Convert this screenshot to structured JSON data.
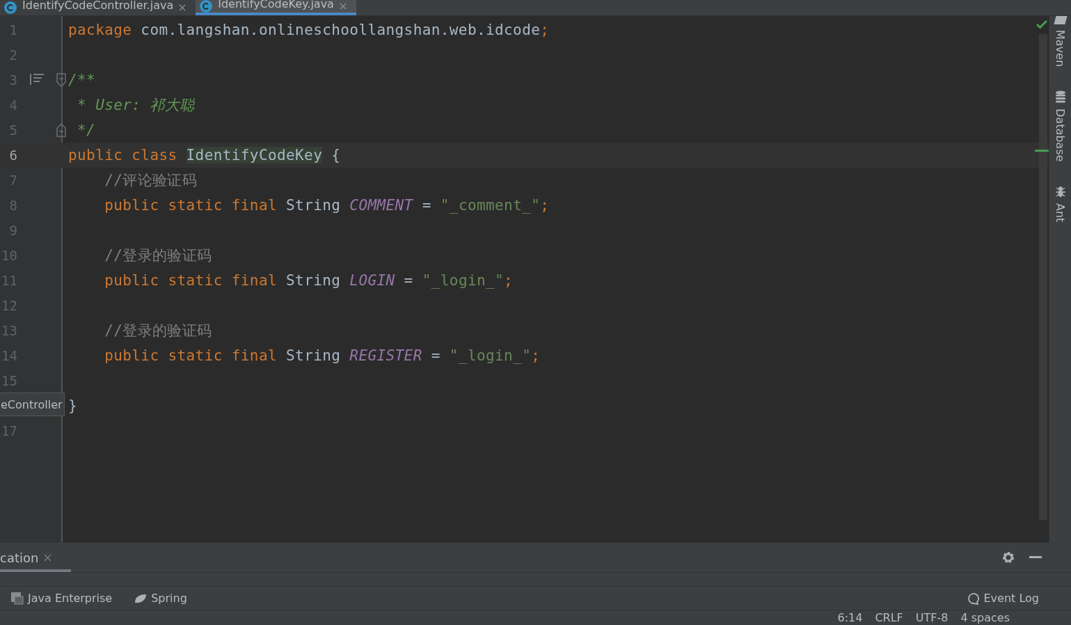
{
  "tabs": [
    {
      "label": "IdentifyCodeController.java",
      "selected": false
    },
    {
      "label": "IdentifyCodeKey.java",
      "selected": true
    }
  ],
  "editor": {
    "lines": [
      {
        "number": "1",
        "kind": "code",
        "current": false,
        "tokens": [
          {
            "kind": "keyword",
            "text": "package"
          },
          {
            "kind": "plain",
            "text": " com.langshan.onlineschoollangshan.web.idcode"
          },
          {
            "kind": "keyword",
            "text": ";"
          }
        ]
      },
      {
        "number": "2",
        "kind": "code",
        "current": false
      },
      {
        "number": "3",
        "kind": "fold-start",
        "current": false,
        "tokens": [
          {
            "kind": "doc",
            "text": "/**"
          }
        ]
      },
      {
        "number": "4",
        "kind": "code",
        "current": false,
        "tokens": [
          {
            "kind": "doc",
            "text": " * User: "
          },
          {
            "kind": "doc",
            "text": "祁大聪"
          }
        ]
      },
      {
        "number": "5",
        "kind": "fold-end",
        "current": false,
        "tokens": [
          {
            "kind": "doc",
            "text": " */"
          }
        ]
      },
      {
        "number": "6",
        "kind": "code",
        "current": true,
        "tokens": [
          {
            "kind": "keyword",
            "text": "public class "
          },
          {
            "kind": "match",
            "text": "IdentifyCodeKey"
          },
          {
            "kind": "plain",
            "text": " {"
          }
        ]
      },
      {
        "number": "7",
        "kind": "code",
        "current": false,
        "tokens": [
          {
            "kind": "comment",
            "text": "    //评论验证码"
          }
        ]
      },
      {
        "number": "8",
        "kind": "code",
        "current": false,
        "tokens": [
          {
            "kind": "keyword",
            "text": "    public static final "
          },
          {
            "kind": "plain",
            "text": "String "
          },
          {
            "kind": "constant",
            "text": "COMMENT"
          },
          {
            "kind": "plain",
            "text": " = "
          },
          {
            "kind": "string",
            "text": "\"_comment_\""
          },
          {
            "kind": "keyword",
            "text": ";"
          }
        ]
      },
      {
        "number": "9",
        "kind": "code",
        "current": false
      },
      {
        "number": "10",
        "kind": "code",
        "current": false,
        "tokens": [
          {
            "kind": "comment",
            "text": "    //登录的验证码"
          }
        ]
      },
      {
        "number": "11",
        "kind": "code",
        "current": false,
        "tokens": [
          {
            "kind": "keyword",
            "text": "    public static final "
          },
          {
            "kind": "plain",
            "text": "String "
          },
          {
            "kind": "constant",
            "text": "LOGIN"
          },
          {
            "kind": "plain",
            "text": " = "
          },
          {
            "kind": "string",
            "text": "\"_login_\""
          },
          {
            "kind": "keyword",
            "text": ";"
          }
        ]
      },
      {
        "number": "12",
        "kind": "code",
        "current": false
      },
      {
        "number": "13",
        "kind": "code",
        "current": false,
        "tokens": [
          {
            "kind": "comment",
            "text": "    //登录的验证码"
          }
        ]
      },
      {
        "number": "14",
        "kind": "code",
        "current": false,
        "tokens": [
          {
            "kind": "keyword",
            "text": "    public static final "
          },
          {
            "kind": "plain",
            "text": "String "
          },
          {
            "kind": "constant",
            "text": "REGISTER"
          },
          {
            "kind": "plain",
            "text": " = "
          },
          {
            "kind": "string",
            "text": "\"_login_\""
          },
          {
            "kind": "keyword",
            "text": ";"
          }
        ]
      },
      {
        "number": "15",
        "kind": "code",
        "current": false
      },
      {
        "kind": "code",
        "current": false,
        "tokens": [
          {
            "kind": "plain",
            "text": "}"
          }
        ]
      },
      {
        "number": "17",
        "kind": "code",
        "current": false
      }
    ],
    "tooltip": "eController"
  },
  "right_sidebar": [
    "Maven",
    "Database",
    "Ant"
  ],
  "tool_window": {
    "tab": {
      "label": "cation",
      "selected": true
    }
  },
  "tool_strip": [
    "Java Enterprise",
    "Spring"
  ],
  "event_log": "Event Log",
  "status_bar": [
    "6:14",
    "CRLF",
    "UTF-8",
    "4 spaces"
  ]
}
